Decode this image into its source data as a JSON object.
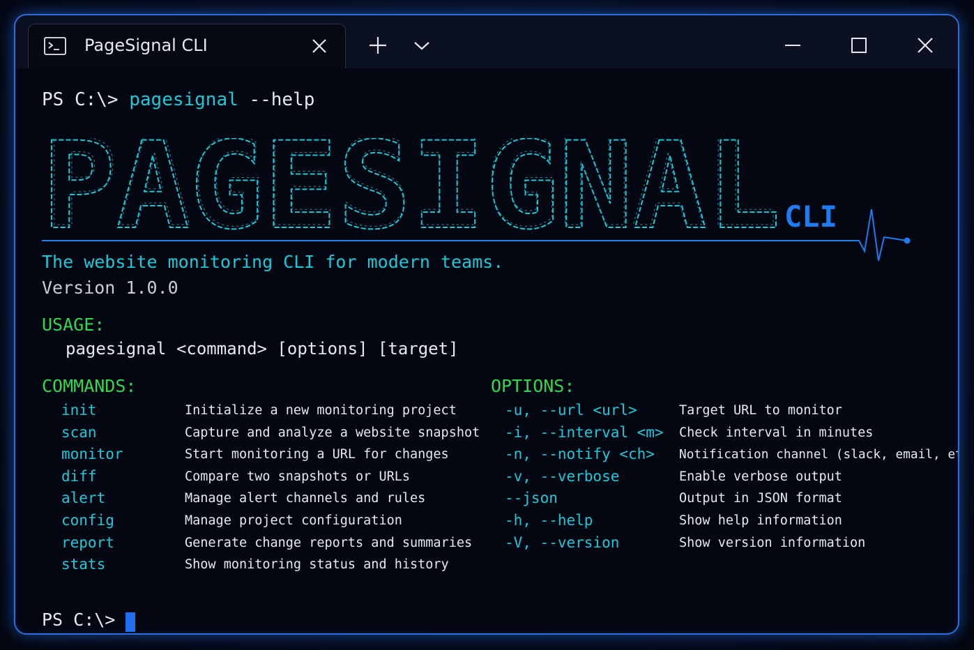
{
  "window": {
    "tab_title": "PageSignal CLI",
    "tab_icon": "terminal-icon"
  },
  "terminal": {
    "command_prompt": "PS C:\\>",
    "command_name": "pagesignal",
    "command_args": "--help",
    "banner_logo_text": "PAGESIGNAL",
    "banner_suffix": "CLI",
    "tagline": "The website monitoring CLI for modern teams.",
    "version": "Version 1.0.0",
    "usage_heading": "USAGE:",
    "usage_line": "pagesignal <command> [options] [target]",
    "commands_heading": "COMMANDS:",
    "options_heading": "OPTIONS:",
    "commands": [
      {
        "name": "init",
        "desc": "Initialize a new monitoring project"
      },
      {
        "name": "scan",
        "desc": "Capture and analyze a website snapshot"
      },
      {
        "name": "monitor",
        "desc": "Start monitoring a URL for changes"
      },
      {
        "name": "diff",
        "desc": "Compare two snapshots or URLs"
      },
      {
        "name": "alert",
        "desc": "Manage alert channels and rules"
      },
      {
        "name": "config",
        "desc": "Manage project configuration"
      },
      {
        "name": "report",
        "desc": "Generate change reports and summaries"
      },
      {
        "name": "stats",
        "desc": "Show monitoring status and history"
      }
    ],
    "options": [
      {
        "flag": "-u, --url <url>",
        "desc": "Target URL to monitor"
      },
      {
        "flag": "-i, --interval <m>",
        "desc": "Check interval in minutes"
      },
      {
        "flag": "-n, --notify <ch>",
        "desc": "Notification channel (slack, email, etc.)"
      },
      {
        "flag": "-v, --verbose",
        "desc": "Enable verbose output"
      },
      {
        "flag": "--json",
        "desc": "Output in JSON format"
      },
      {
        "flag": "-h, --help",
        "desc": "Show help information"
      },
      {
        "flag": "-V, --version",
        "desc": "Show version information"
      }
    ],
    "final_prompt": "PS C:\\>"
  },
  "colors": {
    "accent_cyan": "#1fc8d8",
    "accent_blue": "#1f7cf0",
    "heading_green": "#35d64f",
    "window_border": "#2b6fe0"
  }
}
